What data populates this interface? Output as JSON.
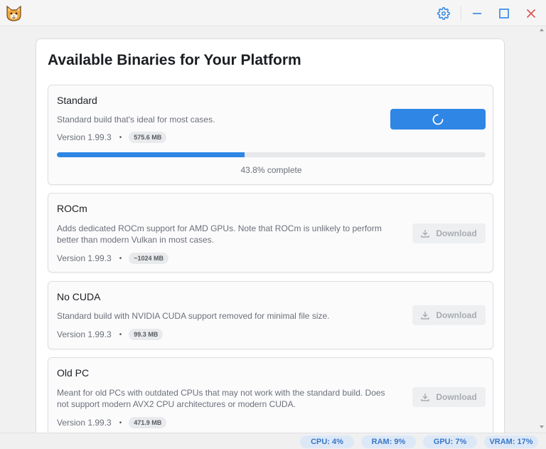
{
  "titlebar": {
    "icons": {
      "app": "cat-face-icon",
      "settings": "gear-icon",
      "minimize": "minimize-icon",
      "maximize": "maximize-icon",
      "close": "close-icon"
    }
  },
  "main": {
    "heading": "Available Binaries for Your Platform",
    "cards": [
      {
        "title": "Standard",
        "description": "Standard build that's ideal for most cases.",
        "version": "Version 1.99.3",
        "separator": "•",
        "size": "575.6 MB",
        "state": "downloading",
        "progress": 0.438,
        "progress_text": "43.8% complete"
      },
      {
        "title": "ROCm",
        "description": "Adds dedicated ROCm support for AMD GPUs. Note that ROCm is unlikely to perform better than modern Vulkan in most cases.",
        "version": "Version 1.99.3",
        "separator": "•",
        "size": "~1024 MB",
        "button": "Download"
      },
      {
        "title": "No CUDA",
        "description": "Standard build with NVIDIA CUDA support removed for minimal file size.",
        "version": "Version 1.99.3",
        "separator": "•",
        "size": "99.3 MB",
        "button": "Download"
      },
      {
        "title": "Old PC",
        "description": "Meant for old PCs with outdated CPUs that may not work with the standard build. Does not support modern AVX2 CPU architectures or modern CUDA.",
        "version": "Version 1.99.3",
        "separator": "•",
        "size": "471.9 MB",
        "button": "Download"
      }
    ]
  },
  "statusbar": {
    "cpu": "CPU: 4%",
    "ram": "RAM: 9%",
    "gpu": "GPU: 7%",
    "vram": "VRAM: 17%"
  },
  "colors": {
    "accent": "#2f86e4",
    "close": "#d9534f",
    "chip_bg": "#dde8f7",
    "chip_text": "#3677c8"
  }
}
